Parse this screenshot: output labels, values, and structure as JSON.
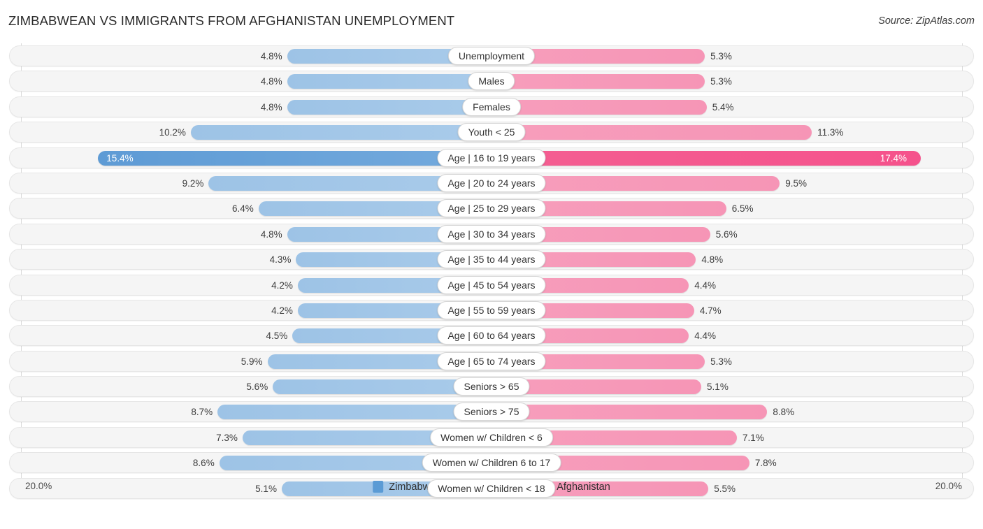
{
  "header": {
    "title": "ZIMBABWEAN VS IMMIGRANTS FROM AFGHANISTAN UNEMPLOYMENT",
    "source": "Source: ZipAtlas.com"
  },
  "axis": {
    "left_label": "20.0%",
    "right_label": "20.0%",
    "max": 20.0
  },
  "legend": {
    "items": [
      {
        "label": "Zimbabwean",
        "color": "#5b9bd5"
      },
      {
        "label": "Immigrants from Afghanistan",
        "color": "#f0548a"
      }
    ]
  },
  "colors": {
    "left_normal": "#a9cbea",
    "right_normal": "#f79ebc",
    "left_highlight": "#5e9bd5",
    "right_highlight": "#f5528c",
    "track": "#f5f5f5",
    "gridline": "#d9d9d9"
  },
  "chart_data": {
    "type": "bar",
    "orientation": "horizontal-diverging",
    "title": "ZIMBABWEAN VS IMMIGRANTS FROM AFGHANISTAN UNEMPLOYMENT",
    "xlabel": "",
    "ylabel": "",
    "xlim": [
      20.0,
      20.0
    ],
    "grid": true,
    "legend_position": "bottom-center",
    "categories": [
      "Unemployment",
      "Males",
      "Females",
      "Youth < 25",
      "Age | 16 to 19 years",
      "Age | 20 to 24 years",
      "Age | 25 to 29 years",
      "Age | 30 to 34 years",
      "Age | 35 to 44 years",
      "Age | 45 to 54 years",
      "Age | 55 to 59 years",
      "Age | 60 to 64 years",
      "Age | 65 to 74 years",
      "Seniors > 65",
      "Seniors > 75",
      "Women w/ Children < 6",
      "Women w/ Children 6 to 17",
      "Women w/ Children < 18"
    ],
    "series": [
      {
        "name": "Zimbabwean",
        "side": "left",
        "values": [
          4.8,
          4.8,
          4.8,
          10.2,
          15.4,
          9.2,
          6.4,
          4.8,
          4.3,
          4.2,
          4.2,
          4.5,
          5.9,
          5.6,
          8.7,
          7.3,
          8.6,
          5.1
        ],
        "labels": [
          "4.8%",
          "4.8%",
          "4.8%",
          "10.2%",
          "15.4%",
          "9.2%",
          "6.4%",
          "4.8%",
          "4.3%",
          "4.2%",
          "4.2%",
          "4.5%",
          "5.9%",
          "5.6%",
          "8.7%",
          "7.3%",
          "8.6%",
          "5.1%"
        ]
      },
      {
        "name": "Immigrants from Afghanistan",
        "side": "right",
        "values": [
          5.3,
          5.3,
          5.4,
          11.3,
          17.4,
          9.5,
          6.5,
          5.6,
          4.8,
          4.4,
          4.7,
          4.4,
          5.3,
          5.1,
          8.8,
          7.1,
          7.8,
          5.5
        ],
        "labels": [
          "5.3%",
          "5.3%",
          "5.4%",
          "11.3%",
          "17.4%",
          "9.5%",
          "6.5%",
          "5.6%",
          "4.8%",
          "4.4%",
          "4.7%",
          "4.4%",
          "5.3%",
          "5.1%",
          "8.8%",
          "7.1%",
          "7.8%",
          "5.5%"
        ]
      }
    ],
    "highlighted_row_index": 4
  }
}
